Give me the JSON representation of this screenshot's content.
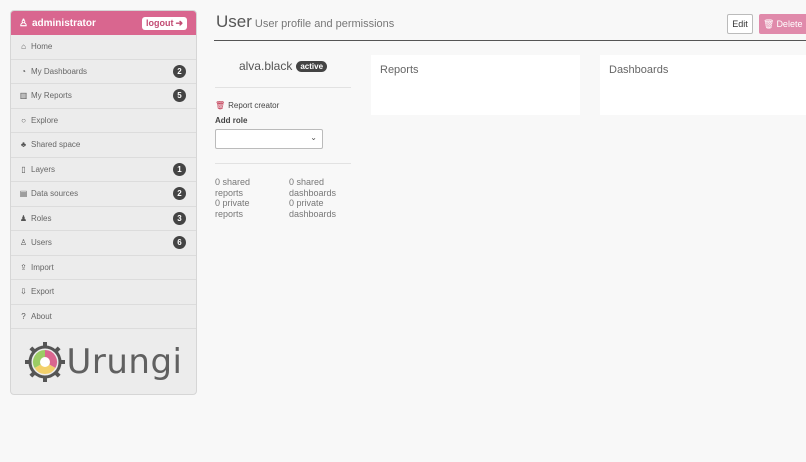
{
  "sidebar": {
    "user": "administrator",
    "logout": "logout",
    "items": [
      {
        "label": "Home",
        "icon": "home-icon",
        "glyph": "⌂",
        "badge": ""
      },
      {
        "label": "My Dashboards",
        "icon": "dashboard-icon",
        "glyph": "◔",
        "badge": "2"
      },
      {
        "label": "My Reports",
        "icon": "bar-chart-icon",
        "glyph": "▥",
        "badge": "5"
      },
      {
        "label": "Explore",
        "icon": "circle-icon",
        "glyph": "○",
        "badge": ""
      },
      {
        "label": "Shared space",
        "icon": "sitemap-icon",
        "glyph": "♣",
        "badge": ""
      },
      {
        "label": "Layers",
        "icon": "map-icon",
        "glyph": "▯",
        "badge": "1"
      },
      {
        "label": "Data sources",
        "icon": "database-icon",
        "glyph": "▤",
        "badge": "2"
      },
      {
        "label": "Roles",
        "icon": "users-icon",
        "glyph": "♟",
        "badge": "3"
      },
      {
        "label": "Users",
        "icon": "user-icon",
        "glyph": "♙",
        "badge": "6"
      },
      {
        "label": "Import",
        "icon": "upload-icon",
        "glyph": "⇪",
        "badge": ""
      },
      {
        "label": "Export",
        "icon": "download-icon",
        "glyph": "⇩",
        "badge": ""
      },
      {
        "label": "About",
        "icon": "question-icon",
        "glyph": "?",
        "badge": ""
      }
    ],
    "logo_text": "Urungi"
  },
  "header": {
    "title": "User",
    "subtitle": "User profile and permissions",
    "edit_label": "Edit",
    "delete_label": "Delete"
  },
  "profile": {
    "username": "alva.black",
    "status": "active",
    "role": "Report creator",
    "add_role_label": "Add role",
    "select_value": "",
    "shared_reports": "0 shared reports",
    "shared_dashboards": "0 shared dashboards",
    "private_reports": "0 private reports",
    "private_dashboards": "0 private dashboards"
  },
  "panels": {
    "reports": "Reports",
    "dashboards": "Dashboards"
  },
  "colors": {
    "accent": "#d9668f",
    "delete": "#e08aab",
    "badge": "#444444"
  }
}
